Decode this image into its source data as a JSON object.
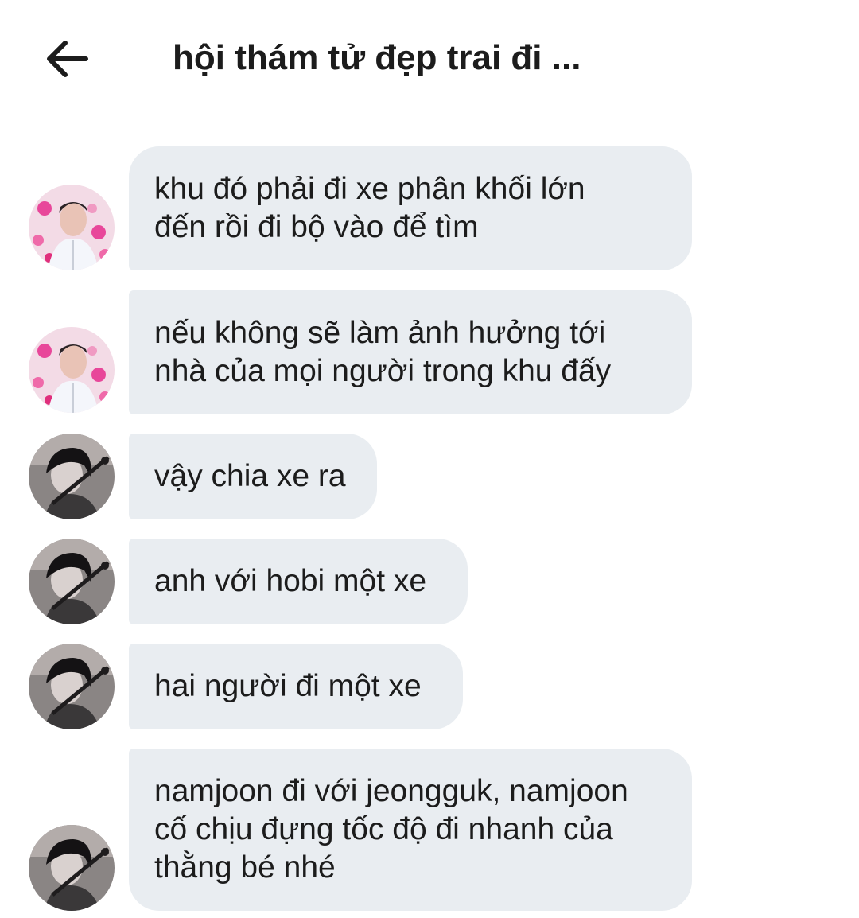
{
  "header": {
    "title": "hội thám tử đẹp trai đi ...",
    "back_icon": "arrow-left-icon"
  },
  "messages": [
    {
      "avatar": "pink-hearts",
      "text": "khu đó phải đi xe phân khối lớn\nđến rồi đi bộ vào để tìm"
    },
    {
      "avatar": "pink-hearts",
      "text": "nếu không sẽ làm ảnh hưởng tới\nnhà của mọi người trong khu đấy"
    },
    {
      "avatar": "dark-sword",
      "text": "vậy chia xe ra"
    },
    {
      "avatar": "dark-sword",
      "text": "anh với hobi một xe"
    },
    {
      "avatar": "dark-sword",
      "text": "hai người đi một xe"
    },
    {
      "avatar": "dark-sword",
      "text": "namjoon đi với jeongguk, namjoon\ncố chịu đựng tốc độ đi nhanh của\nthằng bé nhé"
    }
  ],
  "colors": {
    "bubble": "#e9edf1",
    "text": "#1c1c1c",
    "background": "#ffffff"
  }
}
